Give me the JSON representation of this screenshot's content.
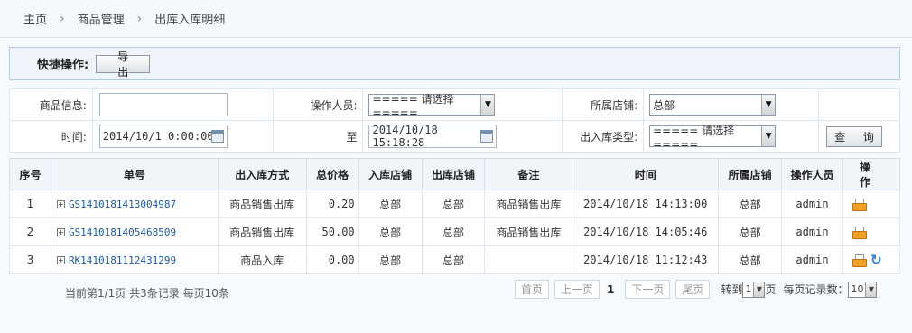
{
  "breadcrumb": [
    "主页",
    "商品管理",
    "出库入库明细"
  ],
  "quickbar": {
    "label": "快捷操作:",
    "export_label": "导 出"
  },
  "filter": {
    "product_info_label": "商品信息:",
    "product_info_value": "",
    "operator_label": "操作人员:",
    "operator_value": "===== 请选择 =====",
    "store_label": "所属店铺:",
    "store_value": "总部",
    "time_label": "时间:",
    "time_from": "2014/10/1 0:00:00",
    "to_label": "至",
    "time_to": "2014/10/18 15:18:28",
    "type_label": "出入库类型:",
    "type_value": "===== 请选择 =====",
    "query_label": "查 询"
  },
  "table": {
    "headers": [
      "序号",
      "单号",
      "出入库方式",
      "总价格",
      "入库店铺",
      "出库店铺",
      "备注",
      "时间",
      "所属店铺",
      "操作人员",
      "操 作"
    ],
    "rows": [
      {
        "idx": "1",
        "no": "GS1410181413004987",
        "mode": "商品销售出库",
        "price": "0.20",
        "in_store": "总部",
        "out_store": "总部",
        "note": "商品销售出库",
        "time": "2014/10/18 14:13:00",
        "store": "总部",
        "operator": "admin"
      },
      {
        "idx": "2",
        "no": "GS1410181405468509",
        "mode": "商品销售出库",
        "price": "50.00",
        "in_store": "总部",
        "out_store": "总部",
        "note": "商品销售出库",
        "time": "2014/10/18 14:05:46",
        "store": "总部",
        "operator": "admin"
      },
      {
        "idx": "3",
        "no": "RK1410181112431299",
        "mode": "商品入库",
        "price": "0.00",
        "in_store": "总部",
        "out_store": "总部",
        "note": "",
        "time": "2014/10/18 11:12:43",
        "store": "总部",
        "operator": "admin"
      }
    ]
  },
  "footer": {
    "info": "当前第1/1页 共3条记录 每页10条",
    "first": "首页",
    "prev": "上一页",
    "current": "1",
    "next": "下一页",
    "last": "尾页",
    "goto_label": "转到",
    "goto_value": "1",
    "page_suffix": "页",
    "per_page_label": "每页记录数：",
    "per_page_value": "10"
  }
}
